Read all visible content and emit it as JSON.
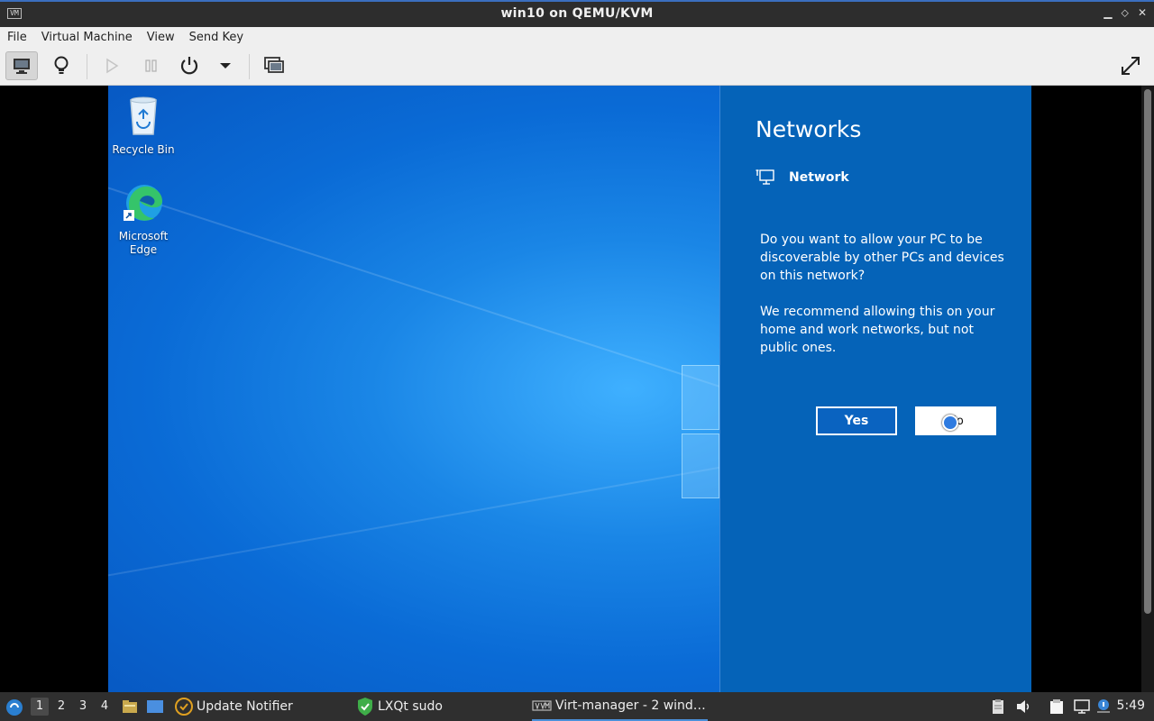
{
  "window": {
    "title": "win10 on QEMU/KVM",
    "app_icon_text": "VM",
    "minimize": "▁",
    "restore": "⬦",
    "close": "✕"
  },
  "menu": [
    "File",
    "Virtual Machine",
    "View",
    "Send Key"
  ],
  "toolbar": {
    "buttons": [
      "monitor-icon",
      "lightbulb-icon",
      "play-icon",
      "pause-icon",
      "power-icon",
      "dropdown-arrow-icon",
      "snapshots-icon",
      "fullscreen-icon"
    ]
  },
  "desktop": {
    "icons": [
      {
        "label": "Recycle Bin",
        "icon": "recycle-bin-icon"
      },
      {
        "label": "Microsoft Edge",
        "icon": "edge-icon"
      }
    ]
  },
  "networks": {
    "title": "Networks",
    "network_name": "Network",
    "question": "Do you want to allow your PC to be discoverable by other PCs and devices on this network?",
    "recommendation": "We recommend allowing this on your home and work networks, but not public ones.",
    "yes_label": "Yes",
    "no_label": "No"
  },
  "taskbar": {
    "workspaces": [
      "1",
      "2",
      "3",
      "4"
    ],
    "active_workspace": "1",
    "tasks": [
      {
        "label": "Update Notifier",
        "icon": "update-notifier-icon"
      },
      {
        "label": "LXQt sudo",
        "icon": "shield-check-icon"
      },
      {
        "label": "Virt-manager - 2 wind…",
        "icon": "virt-manager-icon"
      }
    ],
    "clock": "5:49"
  },
  "colors": {
    "accent": "#0563b8",
    "taskbar": "#2f2f2f",
    "titlebar": "#2d2d2d"
  }
}
